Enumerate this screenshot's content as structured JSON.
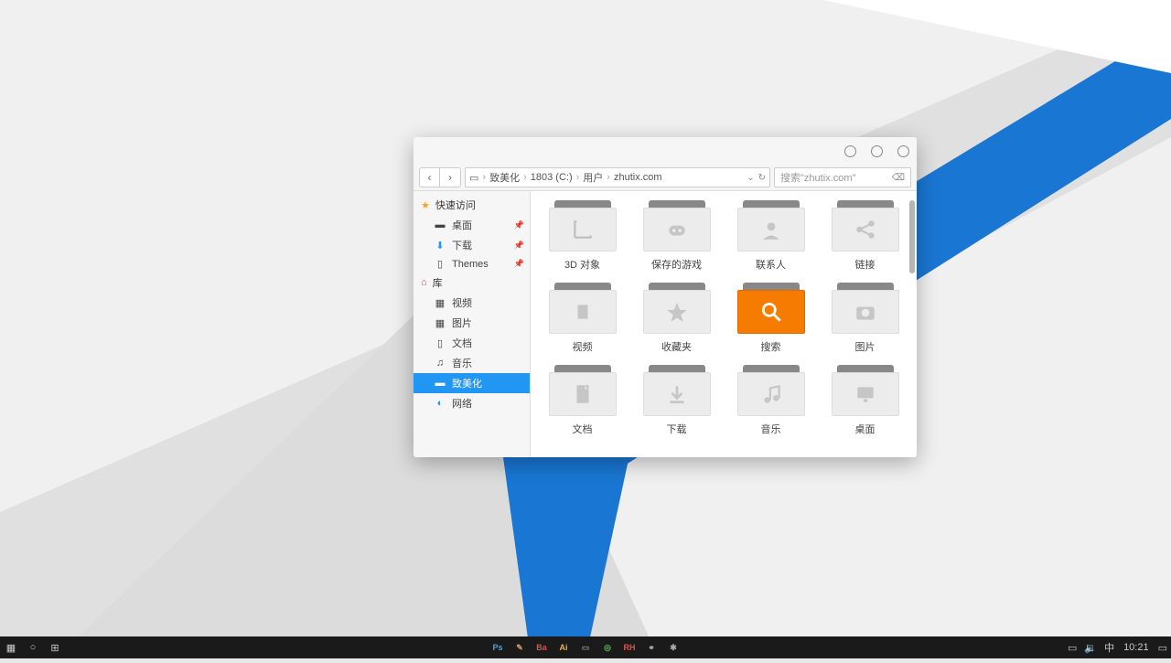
{
  "breadcrumb": {
    "parts": [
      "致美化",
      "1803 (C:)",
      "用户",
      "zhutix.com"
    ]
  },
  "search": {
    "placeholder": "搜索\"zhutix.com\""
  },
  "sidebar": {
    "quick_access": "快速访问",
    "quick_items": [
      {
        "icon": "desktop",
        "label": "桌面",
        "pinned": true
      },
      {
        "icon": "download",
        "label": "下载",
        "pinned": true
      },
      {
        "icon": "folder",
        "label": "Themes",
        "pinned": true
      }
    ],
    "library": "库",
    "lib_items": [
      {
        "icon": "video",
        "label": "视频"
      },
      {
        "icon": "picture",
        "label": "图片"
      },
      {
        "icon": "doc",
        "label": "文档"
      },
      {
        "icon": "music",
        "label": "音乐"
      }
    ],
    "selected": "致美化",
    "network": "网络"
  },
  "folders": [
    {
      "id": "3d",
      "label": "3D 对象",
      "glyph": "ruler"
    },
    {
      "id": "games",
      "label": "保存的游戏",
      "glyph": "gamepad"
    },
    {
      "id": "contacts",
      "label": "联系人",
      "glyph": "person"
    },
    {
      "id": "links",
      "label": "链接",
      "glyph": "share"
    },
    {
      "id": "videos",
      "label": "视频",
      "glyph": "film"
    },
    {
      "id": "favorites",
      "label": "收藏夹",
      "glyph": "star"
    },
    {
      "id": "search",
      "label": "搜索",
      "glyph": "search",
      "orange": true
    },
    {
      "id": "pictures",
      "label": "图片",
      "glyph": "camera"
    },
    {
      "id": "documents",
      "label": "文档",
      "glyph": "page"
    },
    {
      "id": "downloads",
      "label": "下载",
      "glyph": "download"
    },
    {
      "id": "music",
      "label": "音乐",
      "glyph": "note"
    },
    {
      "id": "desktop",
      "label": "桌面",
      "glyph": "monitor"
    }
  ],
  "taskbar": {
    "apps": [
      {
        "id": "ps",
        "label": "Ps",
        "color": "#4aa3df"
      },
      {
        "id": "brush",
        "label": "✎",
        "color": "#cc9966"
      },
      {
        "id": "ba",
        "label": "Ba",
        "color": "#d9534f"
      },
      {
        "id": "ai",
        "label": "Ai",
        "color": "#f0ad4e"
      },
      {
        "id": "mon",
        "label": "▭",
        "color": "#888"
      },
      {
        "id": "chrome",
        "label": "◎",
        "color": "#5cb85c"
      },
      {
        "id": "rh",
        "label": "RH",
        "color": "#d9534f"
      },
      {
        "id": "link",
        "label": "⚭",
        "color": "#aaa"
      },
      {
        "id": "gear",
        "label": "✱",
        "color": "#aaa"
      }
    ],
    "ime": "中",
    "clock": "10:21"
  }
}
